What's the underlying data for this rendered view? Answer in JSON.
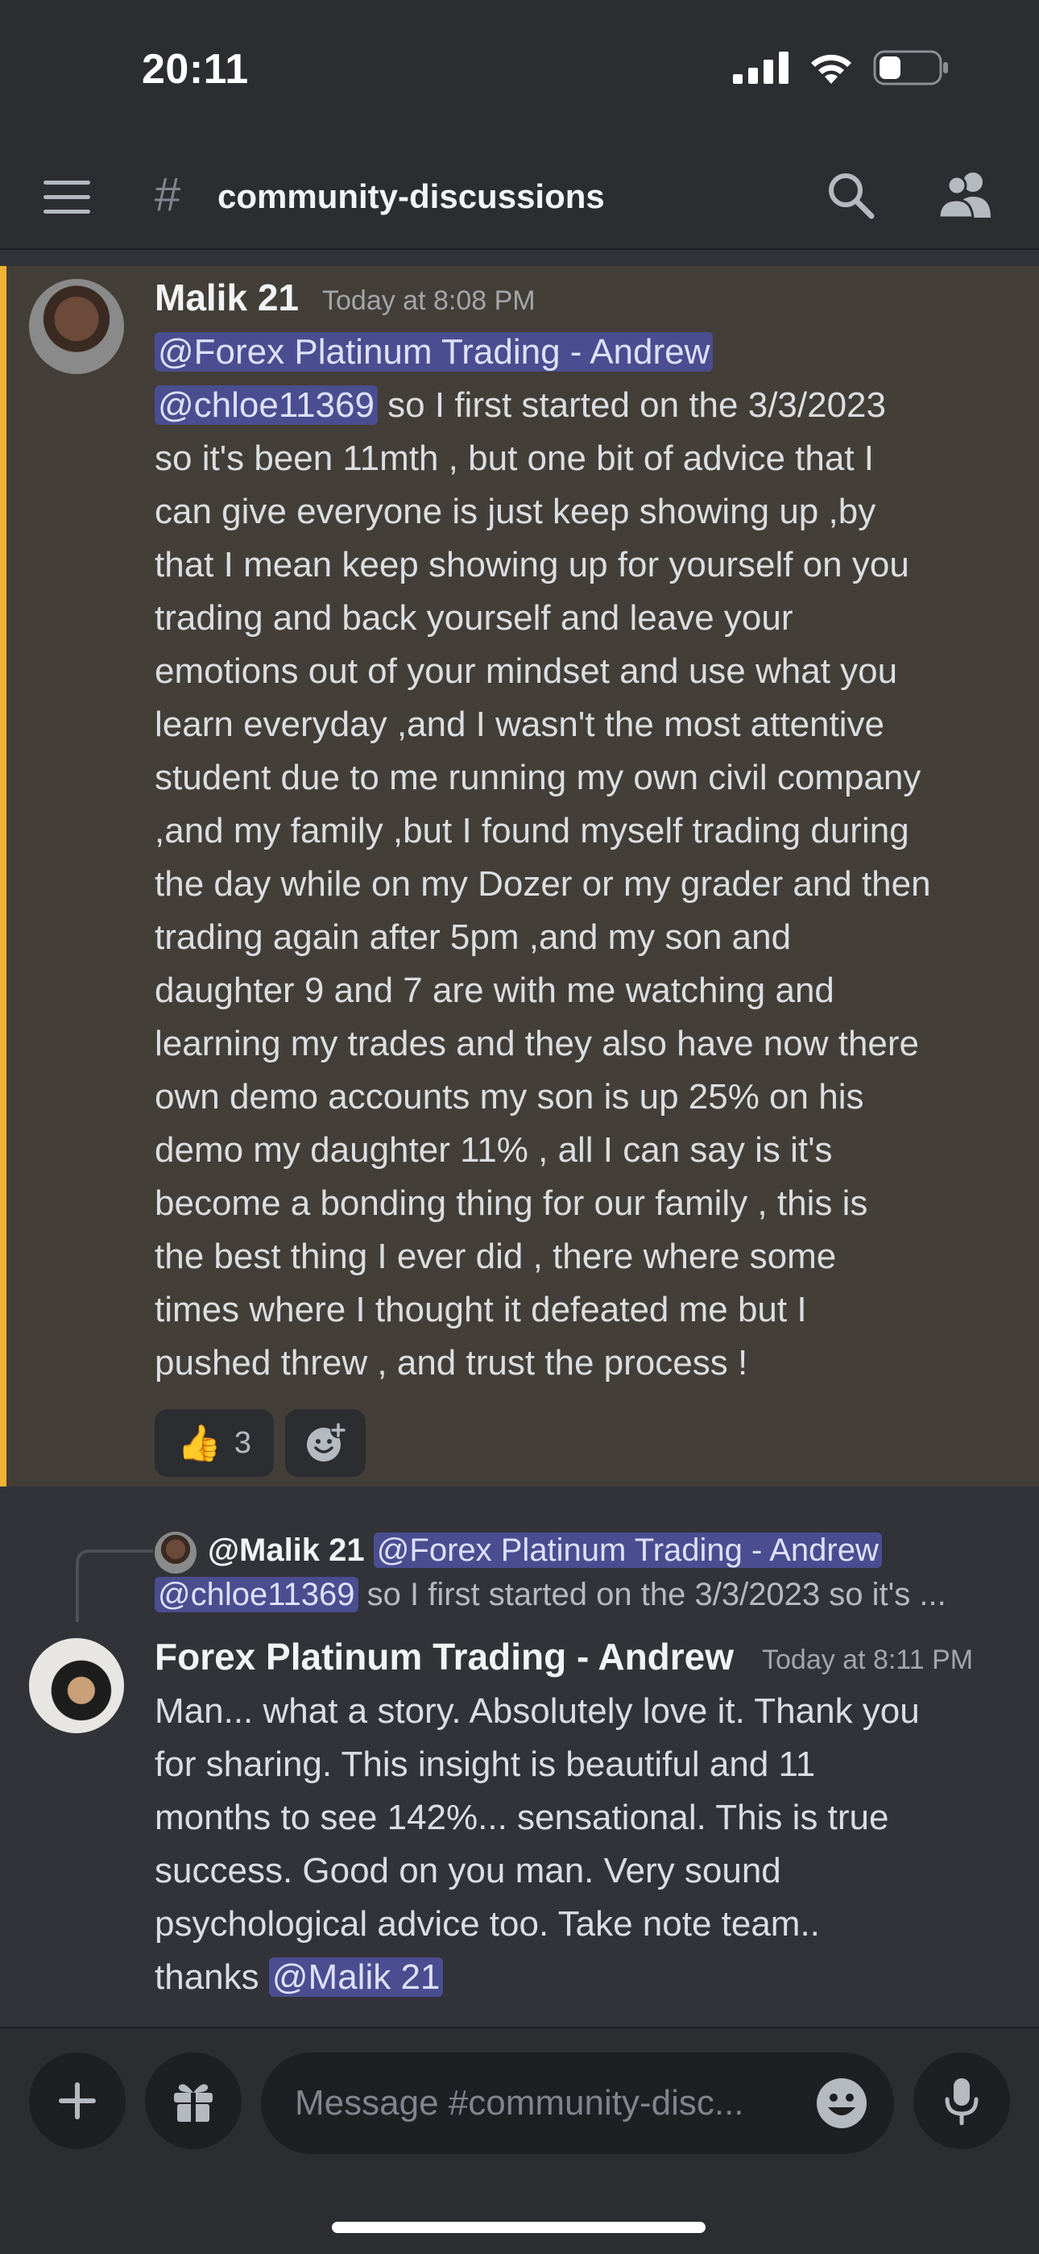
{
  "status_bar": {
    "time": "20:11",
    "icons": [
      "cellular-signal-icon",
      "wifi-icon",
      "battery-icon"
    ]
  },
  "header": {
    "channel_name": "community-discussions",
    "icons": [
      "menu-icon",
      "hash-icon",
      "search-icon",
      "members-icon"
    ]
  },
  "messages": [
    {
      "author": "Malik 21",
      "timestamp": "Today at 8:08 PM",
      "mention_1": "@Forex Platinum Trading - Andrew",
      "mention_2": "@chloe11369",
      "line_2_rest": " so I first started on the 3/3/2023",
      "lines": [
        "so it's been 11mth , but one bit of advice that I",
        "can give everyone is just keep showing up ,by",
        "that I mean keep showing up for yourself on you",
        "trading and back yourself and leave your",
        "emotions out of your mindset  and use what you",
        "learn everyday ,and I wasn't the most attentive",
        "student due to me running my own civil company",
        ",and my family ,but I found myself trading during",
        "the day while on my Dozer or my grader and then",
        "trading again after 5pm ,and my son and",
        "daughter 9 and 7 are with me watching and",
        "learning my trades and they also have now there",
        "own demo accounts my son is up 25% on his",
        "demo my daughter 11% , all I can say is it's",
        "become a bonding thing for our family , this is",
        "the best thing I ever did , there where some",
        "times where I thought it defeated me but I",
        "pushed threw , and trust the process !"
      ],
      "reactions": [
        {
          "emoji": "👍",
          "count": "3"
        }
      ],
      "highlight_color": "#f0b232"
    },
    {
      "reply": {
        "author": "@Malik 21",
        "mention_1": "@Forex Platinum Trading - Andrew",
        "mention_2": "@chloe11369",
        "text": " so I first started on the 3/3/2023 so it's ..."
      },
      "author": "Forex Platinum Trading - Andrew",
      "timestamp": "Today at 8:11 PM",
      "lines": [
        "Man... what a story. Absolutely love it. Thank you",
        "for sharing. This insight is beautiful and 11",
        "months to see 142%... sensational. This is true",
        "success. Good on you man. Very sound",
        "psychological advice too. Take note team.."
      ],
      "last_line_prefix": "thanks ",
      "last_line_mention": "@Malik 21"
    }
  ],
  "composer": {
    "placeholder": "Message #community-disc..."
  },
  "colors": {
    "background": "#313338",
    "header": "#2b2d31",
    "highlight_bg": "#433e38",
    "mention_bg": "#4a4d8f",
    "mention_text": "#dee0fc"
  }
}
